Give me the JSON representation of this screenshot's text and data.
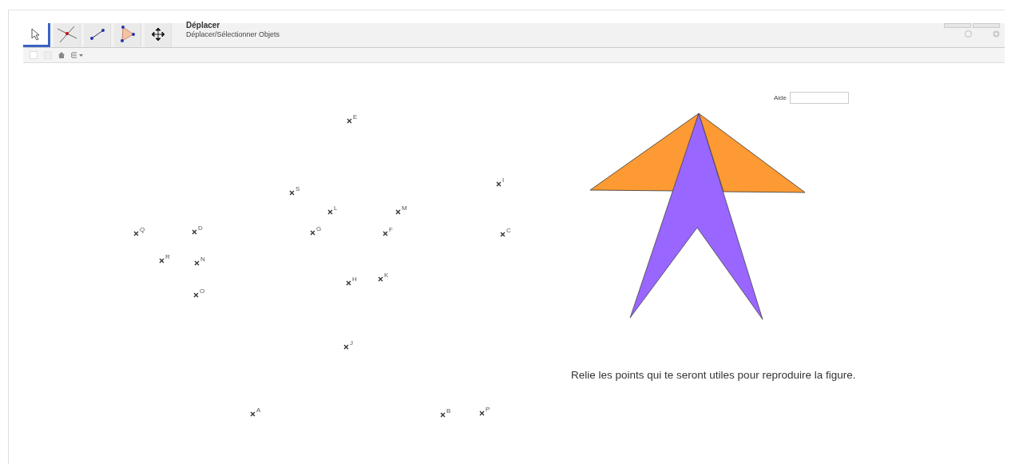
{
  "toolbar": {
    "tools": [
      {
        "kind": "move",
        "selected": true
      },
      {
        "kind": "intersect",
        "selected": false
      },
      {
        "kind": "segment",
        "selected": false
      },
      {
        "kind": "polygon",
        "selected": false
      },
      {
        "kind": "pan",
        "selected": false
      }
    ],
    "tool_title": "Déplacer",
    "tool_description": "Déplacer/Sélectionner Objets"
  },
  "input": {
    "label": "Aide"
  },
  "points": [
    {
      "label": "E"
    },
    {
      "label": "I"
    },
    {
      "label": "S"
    },
    {
      "label": "L"
    },
    {
      "label": "M"
    },
    {
      "label": "Q"
    },
    {
      "label": "D"
    },
    {
      "label": "G"
    },
    {
      "label": "F"
    },
    {
      "label": "C"
    },
    {
      "label": "R"
    },
    {
      "label": "N"
    },
    {
      "label": "K"
    },
    {
      "label": "H"
    },
    {
      "label": "O"
    },
    {
      "label": "J"
    },
    {
      "label": "A"
    },
    {
      "label": "B"
    },
    {
      "label": "P"
    }
  ],
  "instruction": "Relie les points qui te seront utiles pour reproduire la figure."
}
